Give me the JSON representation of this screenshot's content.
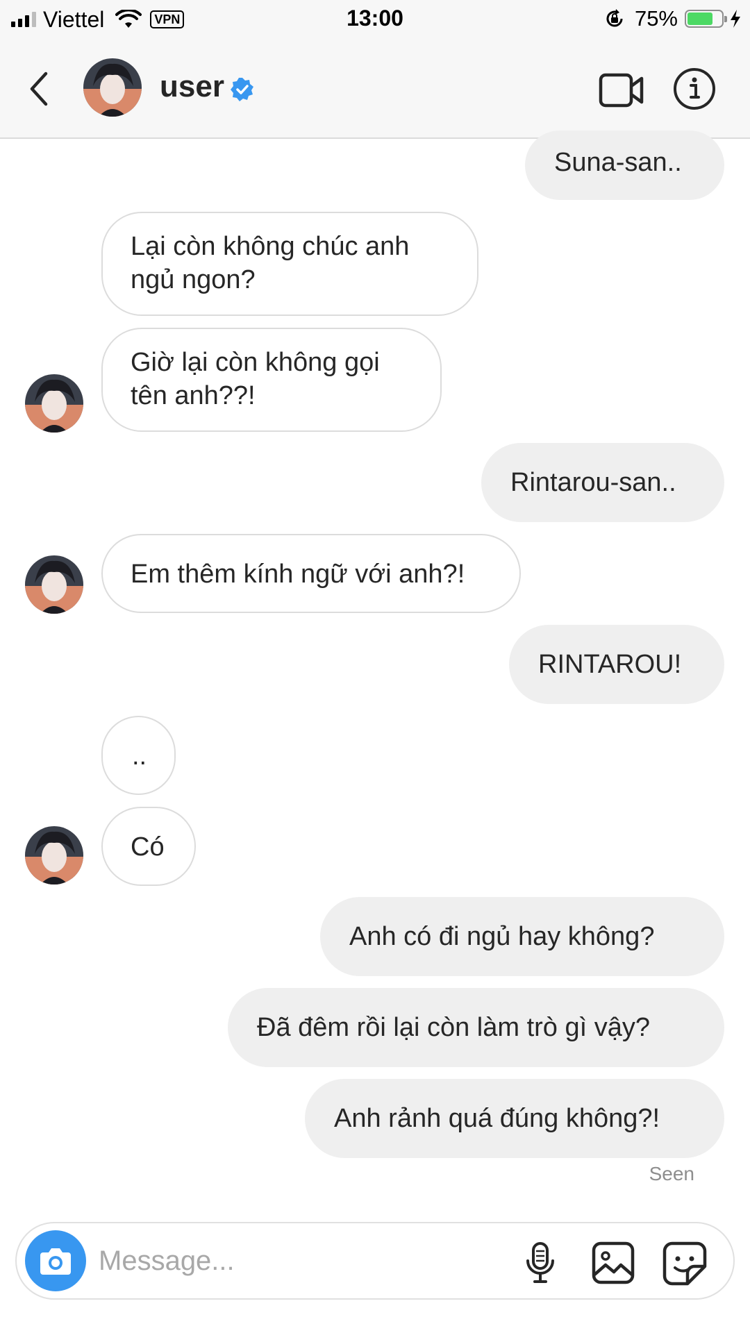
{
  "status_bar": {
    "carrier": "Viettel",
    "vpn": "VPN",
    "time": "13:00",
    "battery": "75%",
    "battery_level": 0.75
  },
  "header": {
    "title": "user",
    "back_icon": "chevron-left-icon",
    "verified_icon": "verified-badge-icon",
    "video_icon": "video-camera-icon",
    "info_icon": "info-icon"
  },
  "messages": [
    {
      "from": "me",
      "text": "Suna-san.."
    },
    {
      "from": "them",
      "text": "Lại còn không chúc anh ngủ ngon?"
    },
    {
      "from": "them",
      "text": "Giờ lại còn không gọi tên anh??!"
    },
    {
      "from": "me",
      "text": "Rintarou-san.."
    },
    {
      "from": "them",
      "text": "Em thêm kính ngữ với anh?!"
    },
    {
      "from": "me",
      "text": "RINTAROU!"
    },
    {
      "from": "them",
      "text": ".."
    },
    {
      "from": "them",
      "text": "Có"
    },
    {
      "from": "me",
      "text": "Anh có đi ngủ hay không?"
    },
    {
      "from": "me",
      "text": "Đã đêm rồi lại còn làm trò gì vậy?"
    },
    {
      "from": "me",
      "text": "Anh rảnh quá đúng không?!"
    }
  ],
  "seen": "Seen",
  "composer": {
    "placeholder": "Message...",
    "camera_icon": "camera-icon",
    "mic_icon": "microphone-icon",
    "gallery_icon": "image-gallery-icon",
    "sticker_icon": "sticker-icon"
  },
  "colors": {
    "accent": "#3897f0",
    "sent_bubble": "#efefef",
    "received_border": "#dcdcdc",
    "battery": "#4cd964"
  }
}
